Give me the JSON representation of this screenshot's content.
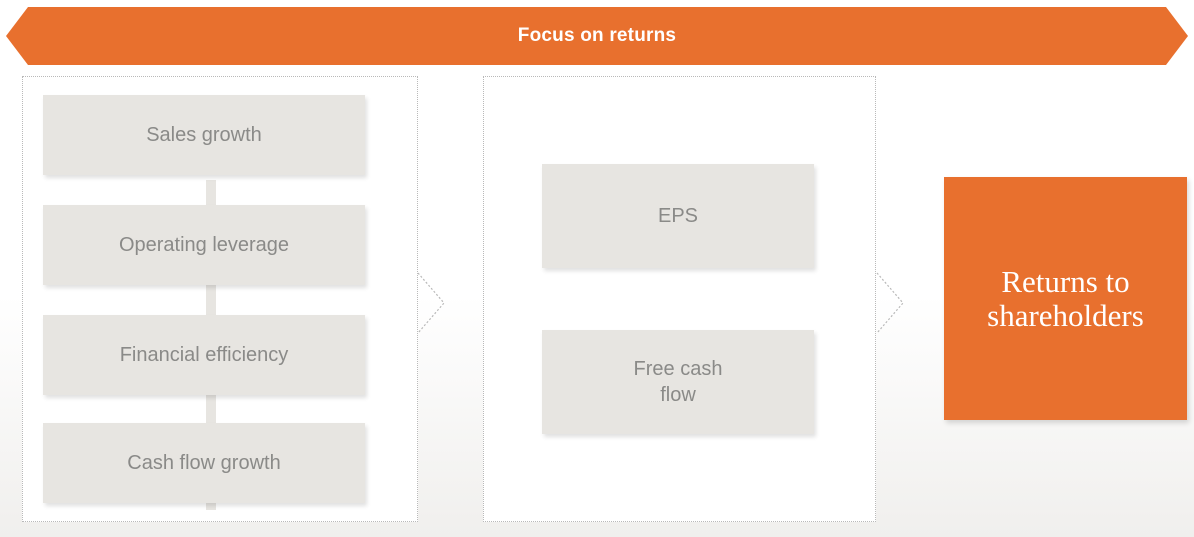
{
  "banner": {
    "title": "Focus on returns"
  },
  "drivers": [
    {
      "label": "Sales growth"
    },
    {
      "label": "Operating leverage"
    },
    {
      "label": "Financial efficiency"
    },
    {
      "label": "Cash flow growth"
    }
  ],
  "metrics": [
    {
      "label": "EPS"
    },
    {
      "label": "Free cash\nflow"
    }
  ],
  "outcome": {
    "label": "Returns to\nshareholders"
  },
  "colors": {
    "accent": "#e8702e",
    "box": "#e7e5e1",
    "box_text": "#8a8a88"
  }
}
